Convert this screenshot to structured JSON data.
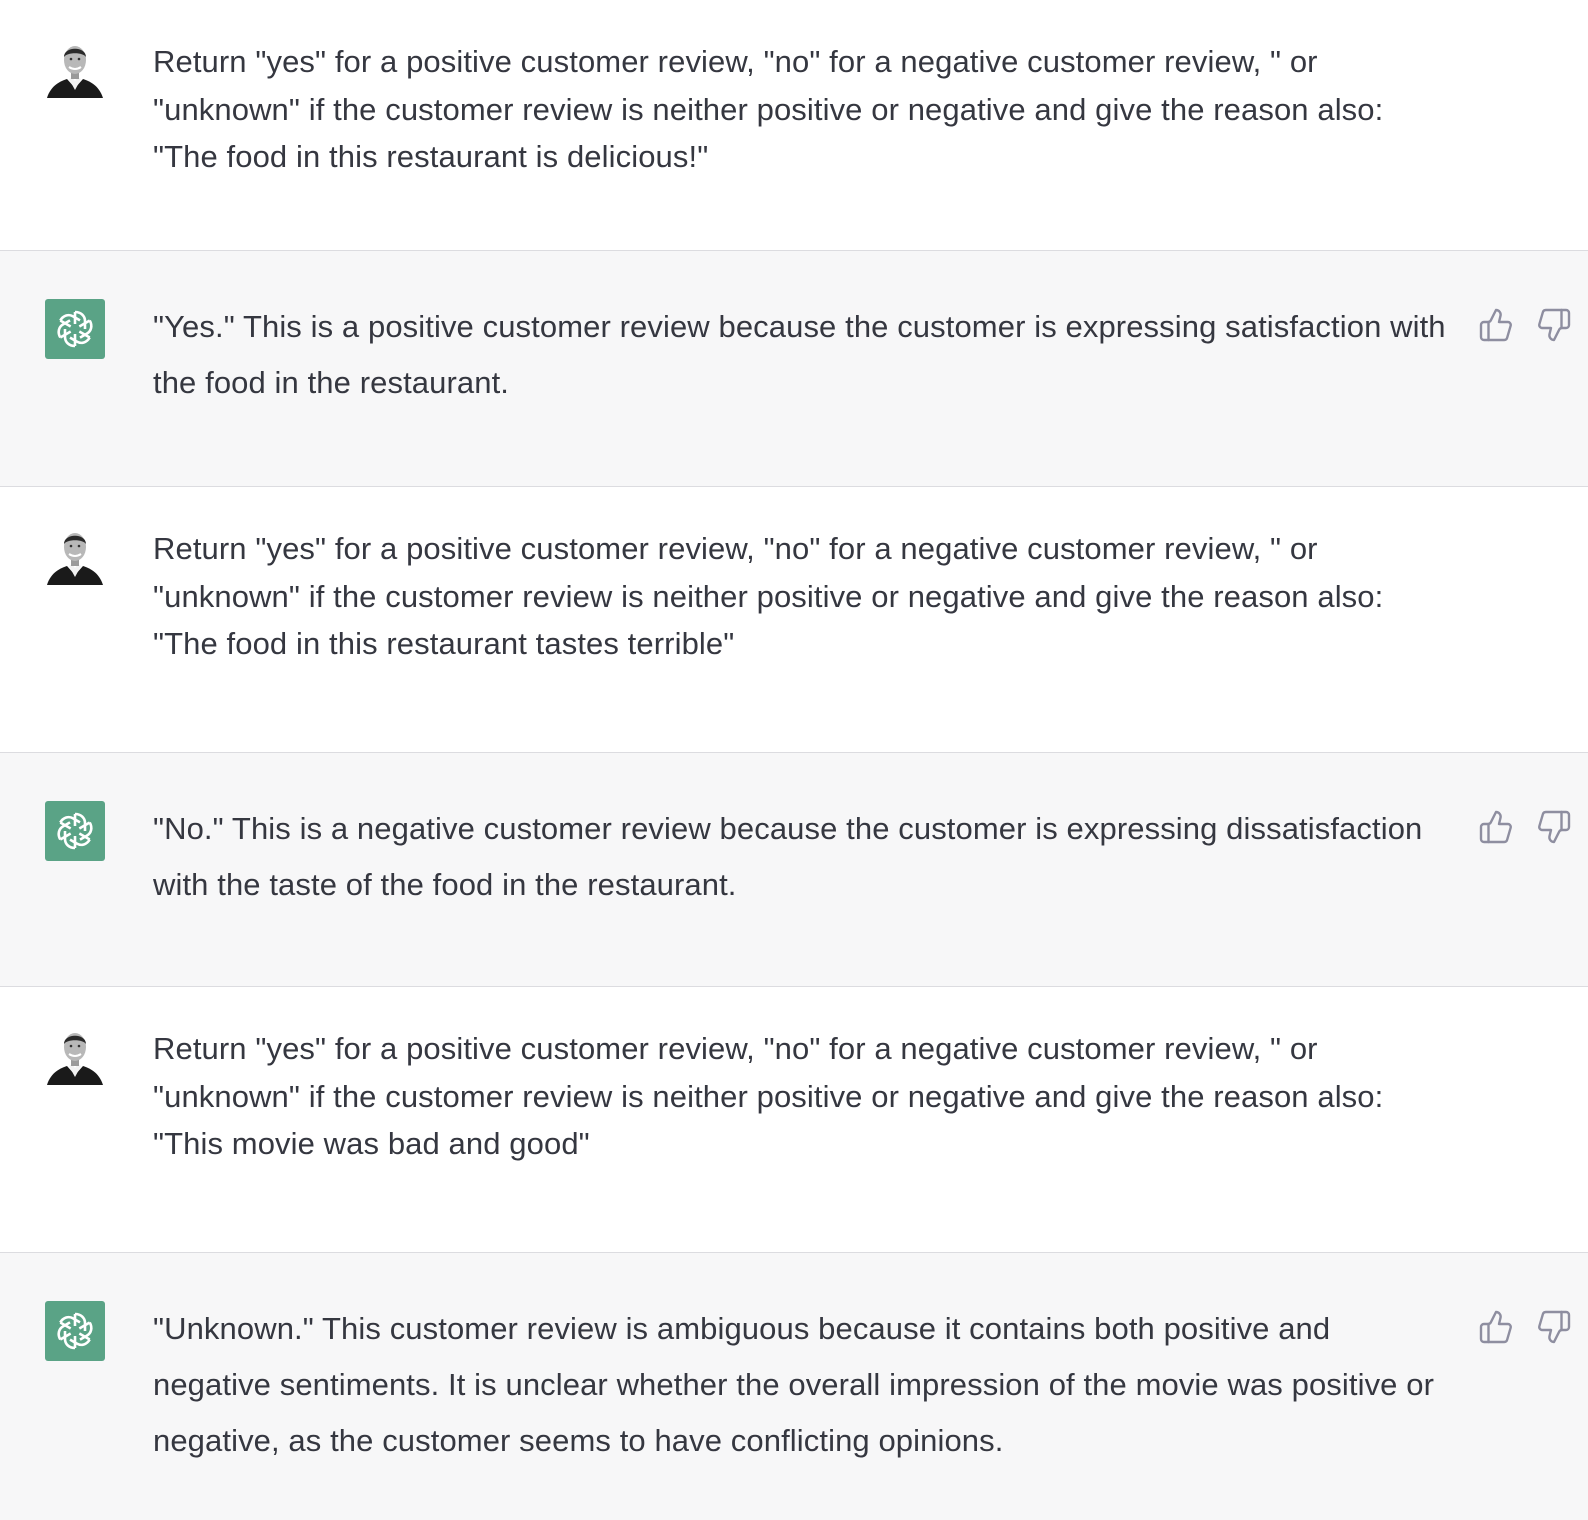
{
  "colors": {
    "user_row_bg": "#ffffff",
    "assistant_row_bg": "#f7f7f8",
    "assistant_avatar_bg": "#5aa386",
    "text": "#353740",
    "feedback_icon": "#8e8ea0"
  },
  "conversation": {
    "messages": [
      {
        "role": "user",
        "avatar_icon": "user-photo-avatar",
        "text": "Return \"yes\" for a positive customer review, \"no\" for a negative customer review, \" or \"unknown\" if the customer review is neither positive or negative and give the reason also: \"The food in this restaurant is delicious!\""
      },
      {
        "role": "assistant",
        "avatar_icon": "openai-logo-icon",
        "text": "\"Yes.\" This is a positive customer review because the customer is expressing satisfaction with the food in the restaurant.",
        "feedback_icons": [
          "thumbs-up-icon",
          "thumbs-down-icon"
        ]
      },
      {
        "role": "user",
        "avatar_icon": "user-photo-avatar",
        "text": "Return \"yes\" for a positive customer review, \"no\" for a negative customer review, \" or \"unknown\" if the customer review is neither positive or negative and give the reason also: \"The food in this restaurant tastes terrible\""
      },
      {
        "role": "assistant",
        "avatar_icon": "openai-logo-icon",
        "text": "\"No.\" This is a negative customer review because the customer is expressing dissatisfaction with the taste of the food in the restaurant.",
        "feedback_icons": [
          "thumbs-up-icon",
          "thumbs-down-icon"
        ]
      },
      {
        "role": "user",
        "avatar_icon": "user-photo-avatar",
        "text": "Return \"yes\" for a positive customer review, \"no\" for a negative customer review, \" or \"unknown\" if the customer review is neither positive or negative and give the reason also: \"This movie was bad and good\""
      },
      {
        "role": "assistant",
        "avatar_icon": "openai-logo-icon",
        "text": "\"Unknown.\" This customer review is ambiguous because it contains both positive and negative sentiments. It is unclear whether the overall impression of the movie was positive or negative, as the customer seems to have conflicting opinions.",
        "feedback_icons": [
          "thumbs-up-icon",
          "thumbs-down-icon"
        ]
      }
    ]
  }
}
